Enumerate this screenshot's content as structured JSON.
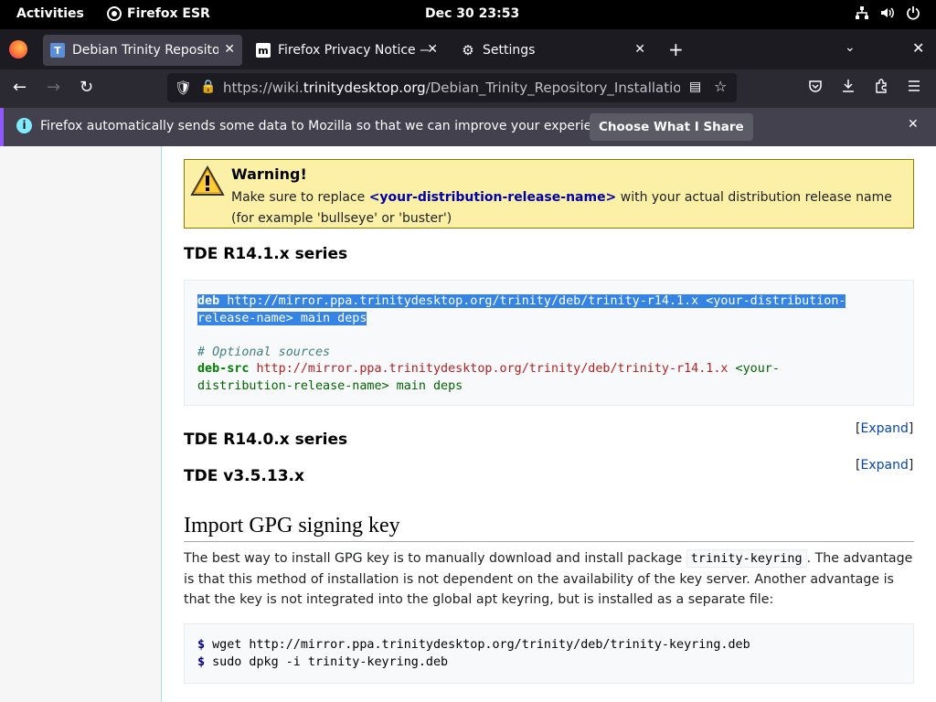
{
  "topbar": {
    "activities": "Activities",
    "app_name": "Firefox ESR",
    "clock": "Dec 30  23:53"
  },
  "tabs": [
    {
      "label": "Debian Trinity Repository",
      "active": true
    },
    {
      "label": "Firefox Privacy Notice — I",
      "active": false
    },
    {
      "label": "Settings",
      "active": false
    }
  ],
  "navbar": {
    "url_prefix": "https://wiki.",
    "url_host": "trinitydesktop.org",
    "url_path": "/Debian_Trinity_Repository_Installation_Ins"
  },
  "notification": {
    "message": "Firefox automatically sends some data to Mozilla so that we can improve your experience.",
    "button": "Choose What I Share"
  },
  "page": {
    "warning": {
      "title": "Warning!",
      "text_before": "Make sure to replace ",
      "placeholder": "<your-distribution-release-name>",
      "text_after": " with your actual distribution release name (for example 'bullseye' or 'buster')"
    },
    "sections": {
      "r141": "TDE R14.1.x series",
      "r140": "TDE R14.0.x series",
      "v35": "TDE v3.5.13.x"
    },
    "code1": {
      "deb_kw": "deb",
      "deb_url": " http://mirror.ppa.trinitydesktop.org/trinity/deb/trinity-r14.1.x <your-distribution-",
      "deb_cont": "release-name> main deps",
      "comment": "# Optional sources",
      "src_kw": "deb-src",
      "src_url": " http://mirror.ppa.trinitydesktop.org/trinity/deb/trinity-r14.1.x",
      "src_tail": " <your-",
      "src_cont": "distribution-release-name> main deps"
    },
    "expand_open": "[",
    "expand_label": "Expand",
    "expand_close": "]",
    "import_heading": "Import GPG signing key",
    "paragraph_before": "The best way to install GPG key is to manually download and install package ",
    "paragraph_code": "trinity-keyring",
    "paragraph_after": ". The advantage is that this method of installation is not dependent on the availability of the key server. Another advantage is that the key is not integrated into the global apt keyring, but is installed as a separate file:",
    "code2": {
      "prompt": "$",
      "line1": " wget http://mirror.ppa.trinitydesktop.org/trinity/deb/trinity-keyring.deb",
      "line2": " sudo dpkg -i trinity-keyring.deb"
    }
  }
}
